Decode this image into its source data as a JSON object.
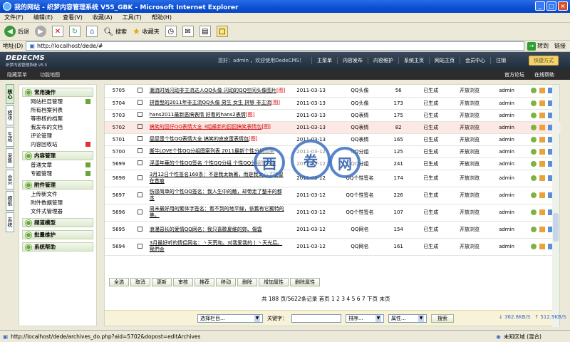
{
  "window": {
    "title": "我的网站 - 织梦内容管理系统 V55_GBK - Microsoft Internet Explorer"
  },
  "menu": [
    "文件(F)",
    "编辑(E)",
    "查看(V)",
    "收藏(A)",
    "工具(T)",
    "帮助(H)"
  ],
  "toolbar": {
    "back": "后退",
    "search": "搜索",
    "favorites": "收藏夹"
  },
  "address": {
    "label": "地址(D)",
    "url": "http://localhost/dede/#",
    "go": "转到",
    "links": "链接"
  },
  "header": {
    "logo": "DEDECMS",
    "logo_sub": "织梦内容管理系统 V5.5",
    "welcome": "您好：admin ，欢迎使用DedeCMS！",
    "nav": [
      "主菜单",
      "内容发布",
      "内容维护",
      "系统主页",
      "网站主页",
      "会员中心",
      "注销"
    ],
    "quick": "快捷方式"
  },
  "subbar": {
    "hide_menu": "隐藏菜单",
    "func_map": "功能地图",
    "forum": "官方论坛",
    "help": "在线帮助"
  },
  "vtabs": [
    "核心",
    "模块",
    "生成",
    "采集",
    "会员",
    "模板",
    "系统"
  ],
  "leftnav": [
    {
      "head": "常用操作",
      "items": [
        "网站栏目管理",
        "所有档案列表",
        "等审核的档案",
        "我发布的文档",
        "评论管理",
        "内容回收站"
      ]
    },
    {
      "head": "内容管理",
      "items": [
        "普通文章",
        "专题管理"
      ]
    },
    {
      "head": "附件管理",
      "items": [
        "上传新文件",
        "附件数据管理",
        "文件式管理器"
      ]
    },
    {
      "head": "频道模型",
      "items": []
    },
    {
      "head": "批量维护",
      "items": []
    },
    {
      "head": "系统帮助",
      "items": []
    }
  ],
  "rows": [
    {
      "id": "5705",
      "title": "潮流时尚闪动非主流达人QQ头像 闪动的QQ空间头像图片",
      "tag": "[图]",
      "date": "2011-03-13",
      "cat": "QQ头像",
      "clicks": "56",
      "status": "已生成",
      "perm": "开放浏览",
      "user": "admin"
    },
    {
      "id": "5704",
      "title": "拼音型的2011年非主流QQ头像 男生 女生 拼够 非主流",
      "tag": "[图]",
      "date": "2011-03-13",
      "cat": "QQ头像",
      "clicks": "173",
      "status": "已生成",
      "perm": "开放浏览",
      "user": "admin"
    },
    {
      "id": "5703",
      "title": "hans2011最新恶搞表情 好看的hans2表情",
      "tag": "[图]",
      "date": "2011-03-13",
      "cat": "QQ表情",
      "clicks": "175",
      "status": "已生成",
      "perm": "开放浏览",
      "user": "admin"
    },
    {
      "id": "5702",
      "title": "搞笑的囧仔QQ表情大全 3组最新的囧囧搞笑表情包",
      "tag": "[图]",
      "date": "2011-03-13",
      "cat": "QQ表情",
      "clicks": "82",
      "status": "已生成",
      "perm": "开放浏览",
      "user": "admin"
    },
    {
      "id": "5701",
      "title": "屁屁蛋个性QQ表情大全 搞笑的皮皮蛋表情包",
      "tag": "[图]",
      "date": "2011-03-13",
      "cat": "QQ表情",
      "clicks": "165",
      "status": "已生成",
      "perm": "开放浏览",
      "user": "admin"
    },
    {
      "id": "5700",
      "title": "撕牛LOVE个性QQ分组图案列表 2011最新个性分组图案",
      "tag": "",
      "date": "2011-03-12",
      "cat": "QQ分组",
      "clicks": "125",
      "status": "已生成",
      "perm": "开放浏览",
      "user": "admin"
    },
    {
      "id": "5699",
      "title": "浮漾年華的个性QQ签名 个性QQ分组 个性QQ分组签名字",
      "tag": "",
      "date": "2011-03-12",
      "cat": "QQ分组",
      "clicks": "241",
      "status": "已生成",
      "perm": "开放浏览",
      "user": "admin"
    },
    {
      "id": "5698",
      "title": "3月12日个性签名160条：不是我太執著，而是我太心了接留在昔痕",
      "tag": "",
      "date": "2011-03-12",
      "cat": "QQ个性签名",
      "clicks": "174",
      "status": "已生成",
      "perm": "开放浏览",
      "user": "admin"
    },
    {
      "id": "5697",
      "title": "伤感简单的个性QQ签名：我人生中的敵，却带走了整丰的都本",
      "tag": "",
      "date": "2011-03-12",
      "cat": "QQ个性签名",
      "clicks": "226",
      "status": "已生成",
      "perm": "开放浏览",
      "user": "admin"
    },
    {
      "id": "5696",
      "title": "周末最好用的繁体字签名：看不到的地平線，依舊有它獨特的美。",
      "tag": "",
      "date": "2011-03-12",
      "cat": "QQ个性签名",
      "clicks": "107",
      "status": "已生成",
      "perm": "开放浏览",
      "user": "admin"
    },
    {
      "id": "5695",
      "title": "浪漫惡长的爱情QQ网名：我只喜歡夏維的妳、傷雲",
      "tag": "",
      "date": "2011-03-12",
      "cat": "QQ网名",
      "clicks": "154",
      "status": "已生成",
      "perm": "开放浏览",
      "user": "admin"
    },
    {
      "id": "5694",
      "title": "3月最好听的情侣网名：丶天荒和。对我爱我的丨丶天光后。我們会",
      "tag": "",
      "date": "2011-03-12",
      "cat": "QQ网名",
      "clicks": "161",
      "status": "已生成",
      "perm": "开放浏览",
      "user": "admin"
    }
  ],
  "actions": [
    "全选",
    "取消",
    "更新",
    "审核",
    "推荐",
    "移动",
    "删除",
    "增加属性",
    "删除属性"
  ],
  "pager": "共 188 页/5622条记录 首页 1 2 3 4 5 6 7 下页 末页",
  "filter": {
    "category": "选择栏目...",
    "keyword_label": "关键字：",
    "order": "排序...",
    "attr": "属性...",
    "search": "搜索"
  },
  "speed": {
    "down": "362.8KB/S",
    "up": "512.9KB/S"
  },
  "status": {
    "url": "http://localhost/dede/archives_do.php?aid=5702&dopost=editArchives",
    "zone": "未知区域 (混合)"
  },
  "watermark": [
    "西",
    "卷",
    "网"
  ]
}
